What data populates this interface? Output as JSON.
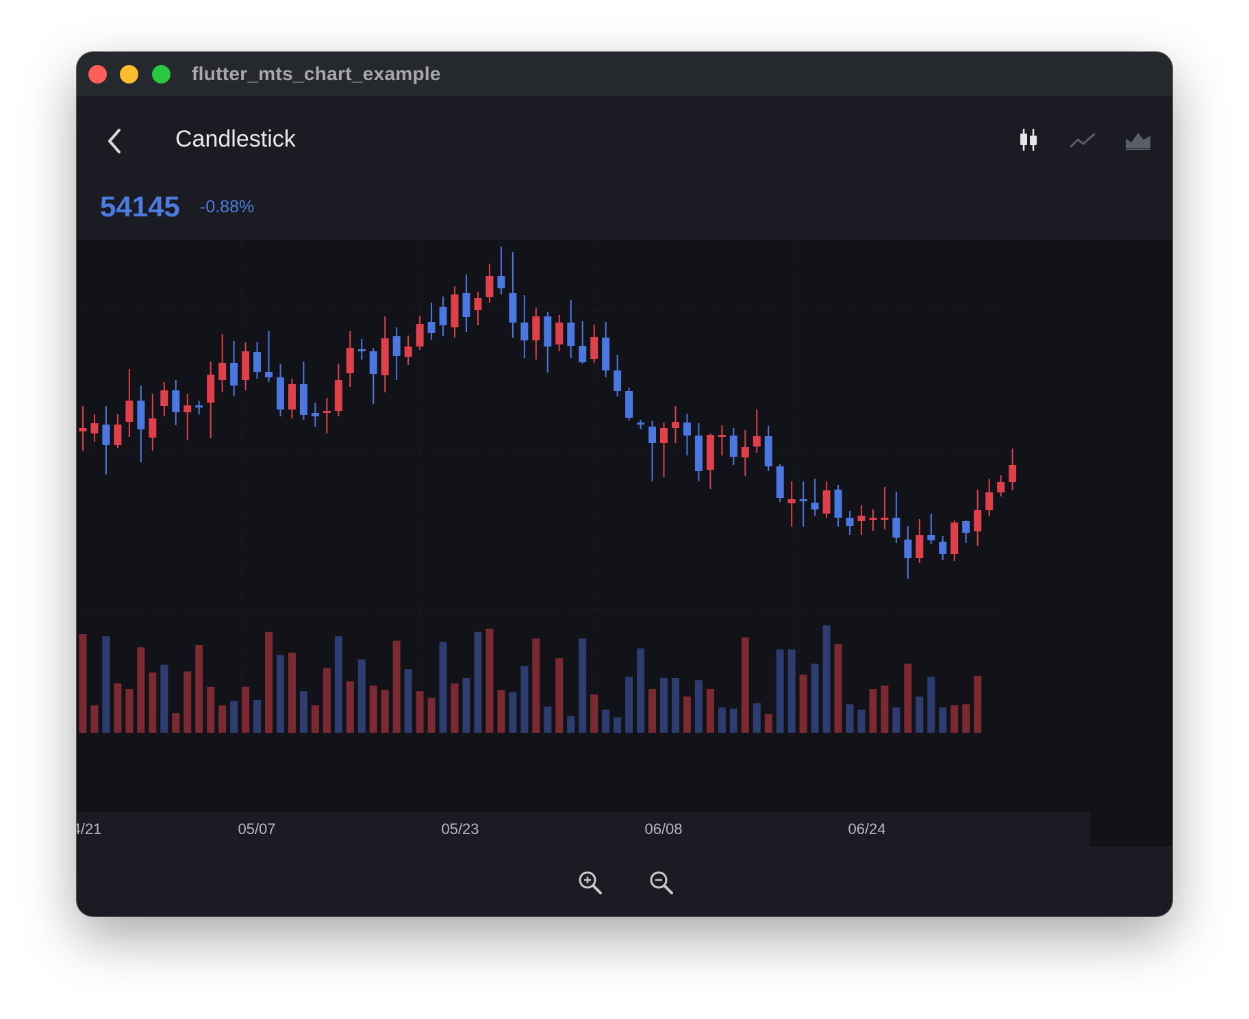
{
  "window": {
    "title": "flutter_mts_chart_example"
  },
  "appbar": {
    "back_icon": "chevron-left-icon",
    "title": "Candlestick",
    "tools": [
      "candlestick-icon",
      "line-chart-icon",
      "area-chart-icon"
    ]
  },
  "quote": {
    "price": "54145",
    "change": "-0.88%"
  },
  "colors": {
    "up": "#e0404a",
    "down": "#4a78e0",
    "up_volume": "#7a2a30",
    "down_volume": "#2d3d70",
    "price": "#4b7ce0"
  },
  "zoom": {
    "in_icon": "zoom-in-icon",
    "out_icon": "zoom-out-icon"
  },
  "chart_data": {
    "type": "candlestick",
    "x_tick_labels": [
      "4/21",
      "05/07",
      "05/23",
      "06/08",
      "06/24"
    ],
    "candles": [
      {
        "o": 3,
        "c": 8,
        "h": 40,
        "l": -25
      },
      {
        "o": 0,
        "c": 15,
        "h": 28,
        "l": -12
      },
      {
        "o": 13,
        "c": -17,
        "h": 40,
        "l": -60
      },
      {
        "o": -17,
        "c": 13,
        "h": 28,
        "l": -21
      },
      {
        "o": 17,
        "c": 48,
        "h": 94,
        "l": -5
      },
      {
        "o": 48,
        "c": 6,
        "h": 70,
        "l": -42
      },
      {
        "o": -6,
        "c": 22,
        "h": 58,
        "l": -25
      },
      {
        "o": 40,
        "c": 63,
        "h": 75,
        "l": 25
      },
      {
        "o": 63,
        "c": 31,
        "h": 78,
        "l": 12
      },
      {
        "o": 31,
        "c": 41,
        "h": 58,
        "l": -10
      },
      {
        "o": 41,
        "c": 39,
        "h": 48,
        "l": 28
      },
      {
        "o": 45,
        "c": 86,
        "h": 105,
        "l": -7
      },
      {
        "o": 78,
        "c": 103,
        "h": 145,
        "l": 60
      },
      {
        "o": 103,
        "c": 70,
        "h": 135,
        "l": 55
      },
      {
        "o": 78,
        "c": 120,
        "h": 133,
        "l": 63
      },
      {
        "o": 119,
        "c": 90,
        "h": 134,
        "l": 80
      },
      {
        "o": 90,
        "c": 82,
        "h": 150,
        "l": 75
      },
      {
        "o": 82,
        "c": 35,
        "h": 102,
        "l": 25
      },
      {
        "o": 35,
        "c": 72,
        "h": 80,
        "l": 22
      },
      {
        "o": 72,
        "c": 27,
        "h": 105,
        "l": 20
      },
      {
        "o": 30,
        "c": 25,
        "h": 45,
        "l": 10
      },
      {
        "o": 30,
        "c": 33,
        "h": 52,
        "l": 0
      },
      {
        "o": 33,
        "c": 78,
        "h": 102,
        "l": 25
      },
      {
        "o": 88,
        "c": 125,
        "h": 150,
        "l": 68
      },
      {
        "o": 123,
        "c": 121,
        "h": 138,
        "l": 108
      },
      {
        "o": 120,
        "c": 87,
        "h": 125,
        "l": 43
      },
      {
        "o": 85,
        "c": 139,
        "h": 171,
        "l": 60
      },
      {
        "o": 142,
        "c": 113,
        "h": 155,
        "l": 78
      },
      {
        "o": 112,
        "c": 127,
        "h": 143,
        "l": 100
      },
      {
        "o": 127,
        "c": 160,
        "h": 172,
        "l": 122
      },
      {
        "o": 163,
        "c": 147,
        "h": 191,
        "l": 137
      },
      {
        "o": 185,
        "c": 158,
        "h": 200,
        "l": 142
      },
      {
        "o": 155,
        "c": 203,
        "h": 215,
        "l": 140
      },
      {
        "o": 205,
        "c": 170,
        "h": 232,
        "l": 148
      },
      {
        "o": 180,
        "c": 198,
        "h": 207,
        "l": 158
      },
      {
        "o": 199,
        "c": 230,
        "h": 248,
        "l": 191
      },
      {
        "o": 230,
        "c": 212,
        "h": 273,
        "l": 203
      },
      {
        "o": 205,
        "c": 162,
        "h": 265,
        "l": 140
      },
      {
        "o": 162,
        "c": 136,
        "h": 202,
        "l": 110
      },
      {
        "o": 136,
        "c": 171,
        "h": 184,
        "l": 108
      },
      {
        "o": 171,
        "c": 127,
        "h": 177,
        "l": 89
      },
      {
        "o": 130,
        "c": 162,
        "h": 173,
        "l": 120
      },
      {
        "o": 162,
        "c": 128,
        "h": 195,
        "l": 110
      },
      {
        "o": 128,
        "c": 104,
        "h": 164,
        "l": 102
      },
      {
        "o": 109,
        "c": 141,
        "h": 159,
        "l": 103
      },
      {
        "o": 140,
        "c": 92,
        "h": 163,
        "l": 82
      },
      {
        "o": 92,
        "c": 62,
        "h": 115,
        "l": 54
      },
      {
        "o": 62,
        "c": 23,
        "h": 67,
        "l": 19
      },
      {
        "o": 16,
        "c": 15,
        "h": 20,
        "l": 6
      },
      {
        "o": 10,
        "c": -14,
        "h": 18,
        "l": -70
      },
      {
        "o": -14,
        "c": 8,
        "h": 16,
        "l": -64
      },
      {
        "o": 8,
        "c": 17,
        "h": 40,
        "l": -14
      },
      {
        "o": 16,
        "c": -3,
        "h": 29,
        "l": -32
      },
      {
        "o": -3,
        "c": -55,
        "h": 15,
        "l": -70
      },
      {
        "o": -53,
        "c": -2,
        "h": 0,
        "l": -81
      },
      {
        "o": -3,
        "c": -2,
        "h": 12,
        "l": -32
      },
      {
        "o": -3,
        "c": -34,
        "h": 8,
        "l": -46
      },
      {
        "o": -35,
        "c": -20,
        "h": 5,
        "l": -62
      },
      {
        "o": -19,
        "c": -4,
        "h": 35,
        "l": -28
      },
      {
        "o": -4,
        "c": -48,
        "h": 11,
        "l": -55
      },
      {
        "o": -48,
        "c": -94,
        "h": -45,
        "l": -100
      },
      {
        "o": -102,
        "c": -96,
        "h": -70,
        "l": -136
      },
      {
        "o": -96,
        "c": -97,
        "h": -70,
        "l": -136
      },
      {
        "o": -101,
        "c": -111,
        "h": -66,
        "l": -120
      },
      {
        "o": -117,
        "c": -83,
        "h": -70,
        "l": -123
      },
      {
        "o": -82,
        "c": -123,
        "h": -75,
        "l": -136
      },
      {
        "o": -123,
        "c": -135,
        "h": -113,
        "l": -148
      },
      {
        "o": -128,
        "c": -120,
        "h": -105,
        "l": -148
      },
      {
        "o": -123,
        "c": -123,
        "h": -111,
        "l": -142
      },
      {
        "o": -123,
        "c": -123,
        "h": -78,
        "l": -140
      },
      {
        "o": -123,
        "c": -152,
        "h": -85,
        "l": -160
      },
      {
        "o": -155,
        "c": -182,
        "h": -135,
        "l": -212
      },
      {
        "o": -182,
        "c": -148,
        "h": -125,
        "l": -189
      },
      {
        "o": -148,
        "c": -156,
        "h": -117,
        "l": -161
      },
      {
        "o": -158,
        "c": -176,
        "h": -150,
        "l": -185
      },
      {
        "o": -176,
        "c": -130,
        "h": -127,
        "l": -186
      },
      {
        "o": -128,
        "c": -145,
        "h": -127,
        "l": -160
      },
      {
        "o": -143,
        "c": -112,
        "h": -82,
        "l": -164
      },
      {
        "o": -112,
        "c": -86,
        "h": -66,
        "l": -121
      },
      {
        "o": -86,
        "c": -71,
        "h": -61,
        "l": -92
      },
      {
        "o": -71,
        "c": -46,
        "h": -22,
        "l": -83
      }
    ],
    "volume": [
      90,
      25,
      88,
      45,
      40,
      78,
      55,
      62,
      18,
      56,
      80,
      42,
      25,
      29,
      42,
      30,
      92,
      71,
      73,
      38,
      25,
      59,
      88,
      47,
      67,
      43,
      39,
      84,
      58,
      38,
      32,
      83,
      45,
      50,
      92,
      95,
      39,
      37,
      61,
      86,
      24,
      68,
      15,
      86,
      35,
      21,
      14,
      51,
      77,
      40,
      50,
      50,
      33,
      48,
      40,
      23,
      22,
      87,
      27,
      17,
      76,
      76,
      53,
      63,
      98,
      81,
      26,
      21,
      40,
      43,
      23,
      63,
      33,
      51,
      23,
      25,
      26,
      52
    ],
    "volume_up": [
      true,
      true,
      false,
      true,
      true,
      true,
      true,
      false,
      true,
      true,
      true,
      true,
      true,
      false,
      true,
      false,
      true,
      false,
      true,
      false,
      true,
      true,
      false,
      true,
      false,
      true,
      true,
      true,
      false,
      true,
      true,
      false,
      true,
      false,
      false,
      true,
      true,
      false,
      false,
      true,
      false,
      true,
      false,
      false,
      true,
      false,
      false,
      false,
      false,
      true,
      false,
      false,
      true,
      false,
      true,
      false,
      false,
      true,
      false,
      true,
      false,
      false,
      true,
      false,
      false,
      true,
      false,
      false,
      true,
      true,
      false,
      true,
      false,
      false,
      false,
      true,
      true,
      true
    ]
  }
}
